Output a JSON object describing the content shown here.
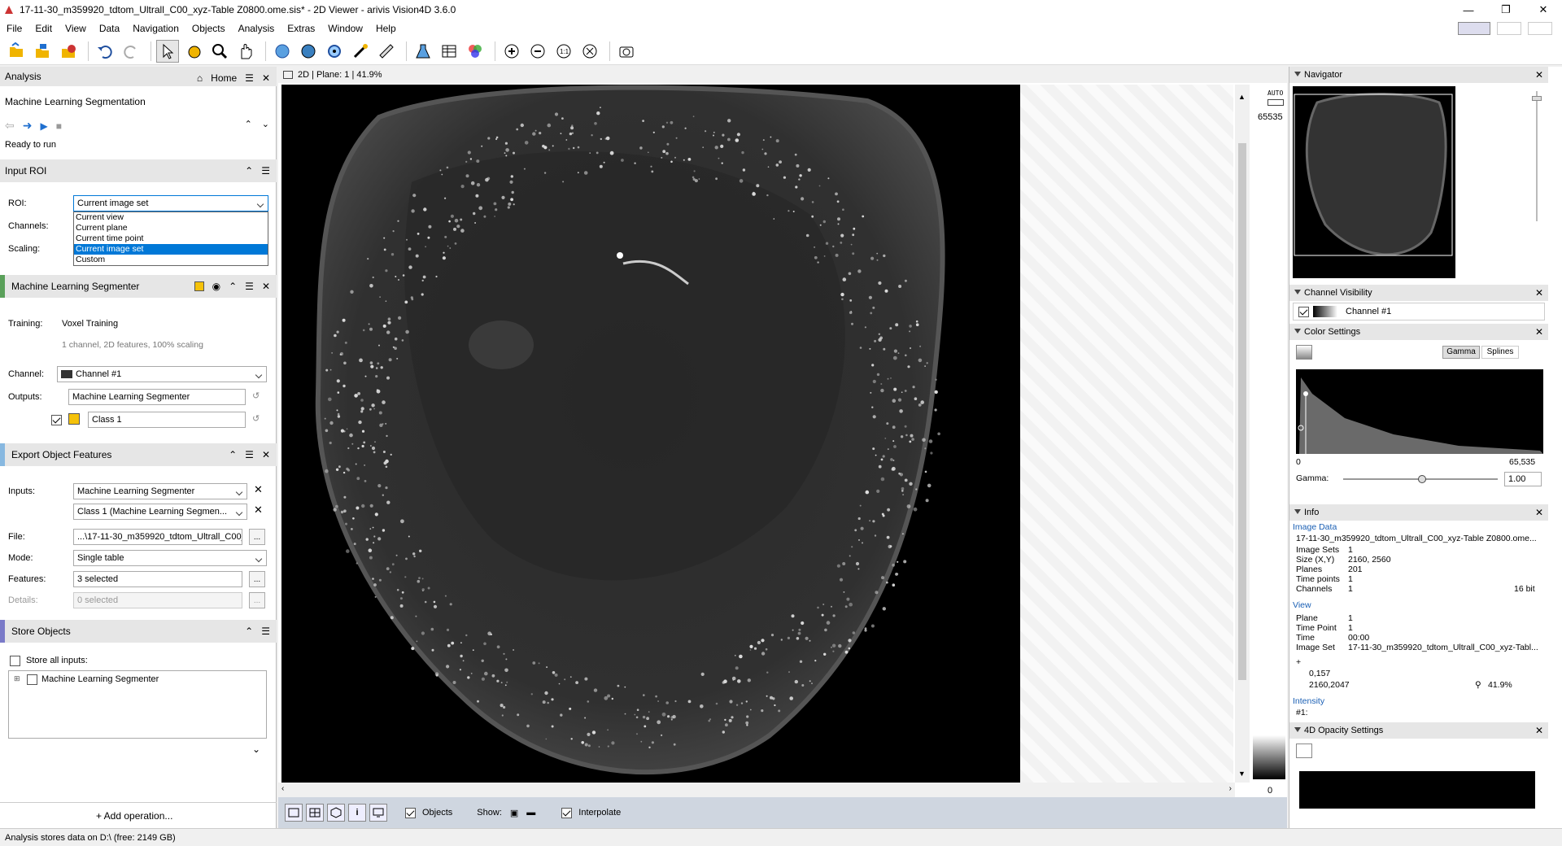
{
  "window": {
    "title": "17-11-30_m359920_tdtom_Ultrall_C00_xyz-Table Z0800.ome.sis* - 2D Viewer - arivis Vision4D 3.6.0"
  },
  "menu": [
    "File",
    "Edit",
    "View",
    "Data",
    "Navigation",
    "Objects",
    "Analysis",
    "Extras",
    "Window",
    "Help"
  ],
  "analysis": {
    "tab_label": "Analysis",
    "home_label": "Home",
    "pipeline_name": "Machine Learning Segmentation",
    "run_status": "Ready to run"
  },
  "input_roi": {
    "title": "Input ROI",
    "roi_label": "ROI:",
    "roi_value": "Current image set",
    "channels_label": "Channels:",
    "scaling_label": "Scaling:",
    "options": [
      "Current view",
      "Current plane",
      "Current time point",
      "Current image set",
      "Custom"
    ],
    "selected_option": "Current image set"
  },
  "ml_segmenter": {
    "title": "Machine Learning Segmenter",
    "training_label": "Training:",
    "training_value": "Voxel Training",
    "training_info": "1 channel, 2D features, 100% scaling",
    "channel_label": "Channel:",
    "channel_value": "Channel #1",
    "outputs_label": "Outputs:",
    "outputs_value": "Machine Learning Segmenter",
    "class_value": "Class 1",
    "class_color": "#f5c20a"
  },
  "export_features": {
    "title": "Export Object Features",
    "inputs_label": "Inputs:",
    "input1": "Machine Learning Segmenter",
    "input2": "Class 1 (Machine Learning Segmen...",
    "file_label": "File:",
    "file_value": "...\\17-11-30_m359920_tdtom_Ultrall_C00_",
    "mode_label": "Mode:",
    "mode_value": "Single table",
    "features_label": "Features:",
    "features_value": "3 selected",
    "details_label": "Details:",
    "details_value": "0 selected",
    "browse_label": "..."
  },
  "store_objects": {
    "title": "Store Objects",
    "store_all_label": "Store all inputs:",
    "tree_item": "Machine Learning Segmenter"
  },
  "add_operation_label": "+ Add operation...",
  "status_bar": "Analysis stores data on D:\\ (free: 2149 GB)",
  "viewer": {
    "header": "2D  |  Plane: 1  |  41.9%",
    "auto_label": "AUTO",
    "max_value": "65535",
    "min_value": "0",
    "objects_label": "Objects",
    "show_label": "Show:",
    "interpolate_label": "Interpolate"
  },
  "navigator": {
    "title": "Navigator"
  },
  "channel_visibility": {
    "title": "Channel Visibility",
    "channel": "Channel #1"
  },
  "color_settings": {
    "title": "Color Settings",
    "gamma_tab": "Gamma",
    "splines_tab": "Splines",
    "hist_min": "0",
    "hist_max": "65,535",
    "gamma_label": "Gamma:",
    "gamma_value": "1.00"
  },
  "info": {
    "title": "Info",
    "image_data_label": "Image Data",
    "filename": "17-11-30_m359920_tdtom_Ultrall_C00_xyz-Table Z0800.ome...",
    "rows": [
      {
        "k": "Image Sets",
        "v": "1"
      },
      {
        "k": "Size (X,Y)",
        "v": "2160, 2560"
      },
      {
        "k": "Planes",
        "v": "201"
      },
      {
        "k": "Time points",
        "v": "1"
      },
      {
        "k": "Channels",
        "v": "1"
      }
    ],
    "bit_depth": "16 bit",
    "view_label": "View",
    "view_rows": [
      {
        "k": "Plane",
        "v": "1"
      },
      {
        "k": "Time Point",
        "v": "1"
      },
      {
        "k": "Time",
        "v": "00:00"
      },
      {
        "k": "Image Set",
        "v": "17-11-30_m359920_tdtom_Ultrall_C00_xyz-Tabl..."
      }
    ],
    "plus": "+",
    "coord": "0,157",
    "extent": "2160,2047",
    "zoom": "41.9%",
    "intensity_label": "Intensity",
    "intensity_value": "#1:"
  },
  "opacity": {
    "title": "4D Opacity Settings"
  }
}
